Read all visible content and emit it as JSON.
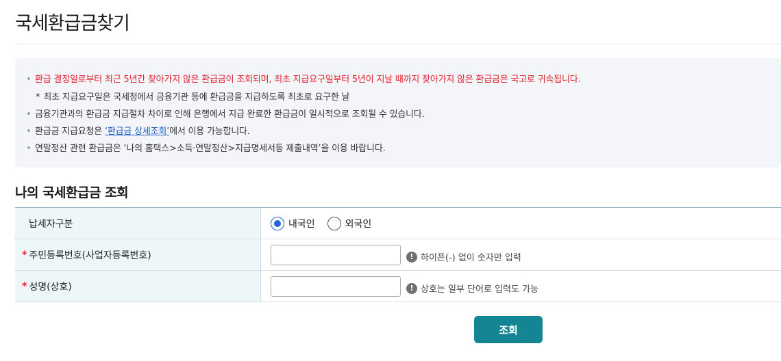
{
  "page": {
    "title": "국세환급금찾기"
  },
  "notice": {
    "line1": "환급 결정일로부터 최근 5년간 찾아가지 않은 환급금이 조회되며, 최초 지급요구일부터 5년이 지날 때까지 찾아가지 않은 환급금은 국고로 귀속됩니다.",
    "line1_sub": "최초 지급요구일은 국세청에서 금융기관 등에 환급금을 지급하도록 최초로 요구한 날",
    "line2": "금융기관과의 환급금 지급절차 차이로 인해 은행에서 지급 완료한 환급금이 일시적으로 조회될 수 있습니다.",
    "line3_prefix": "환급금 지급요청은 ",
    "line3_link": "‘환급금 상세조회’",
    "line3_suffix": "에서 이용 가능합니다.",
    "line4": "연말정산 관련 환급금은 ‘나의 홈택스>소득·연말정산>지급명세서등 제출내역’을 이용 바랍니다.",
    "star": "*"
  },
  "section": {
    "title": "나의 국세환급금 조회"
  },
  "form": {
    "required_mark": "*",
    "taxpayer_type": {
      "label": "납세자구분",
      "options": [
        "내국인",
        "외국인"
      ],
      "selected": "내국인"
    },
    "resident_number": {
      "label": "주민등록번호(사업자등록번호)",
      "value": "",
      "hint": "하이픈(-) 없이 숫자만 입력"
    },
    "name": {
      "label": "성명(상호)",
      "value": "",
      "hint": "상호는 일부 단어로 입력도 가능"
    },
    "info_glyph": "!"
  },
  "actions": {
    "submit_label": "조회"
  },
  "colors": {
    "accent": "#138593",
    "warning": "#e0232c",
    "link": "#1a5fc7",
    "radio": "#2563d9"
  }
}
